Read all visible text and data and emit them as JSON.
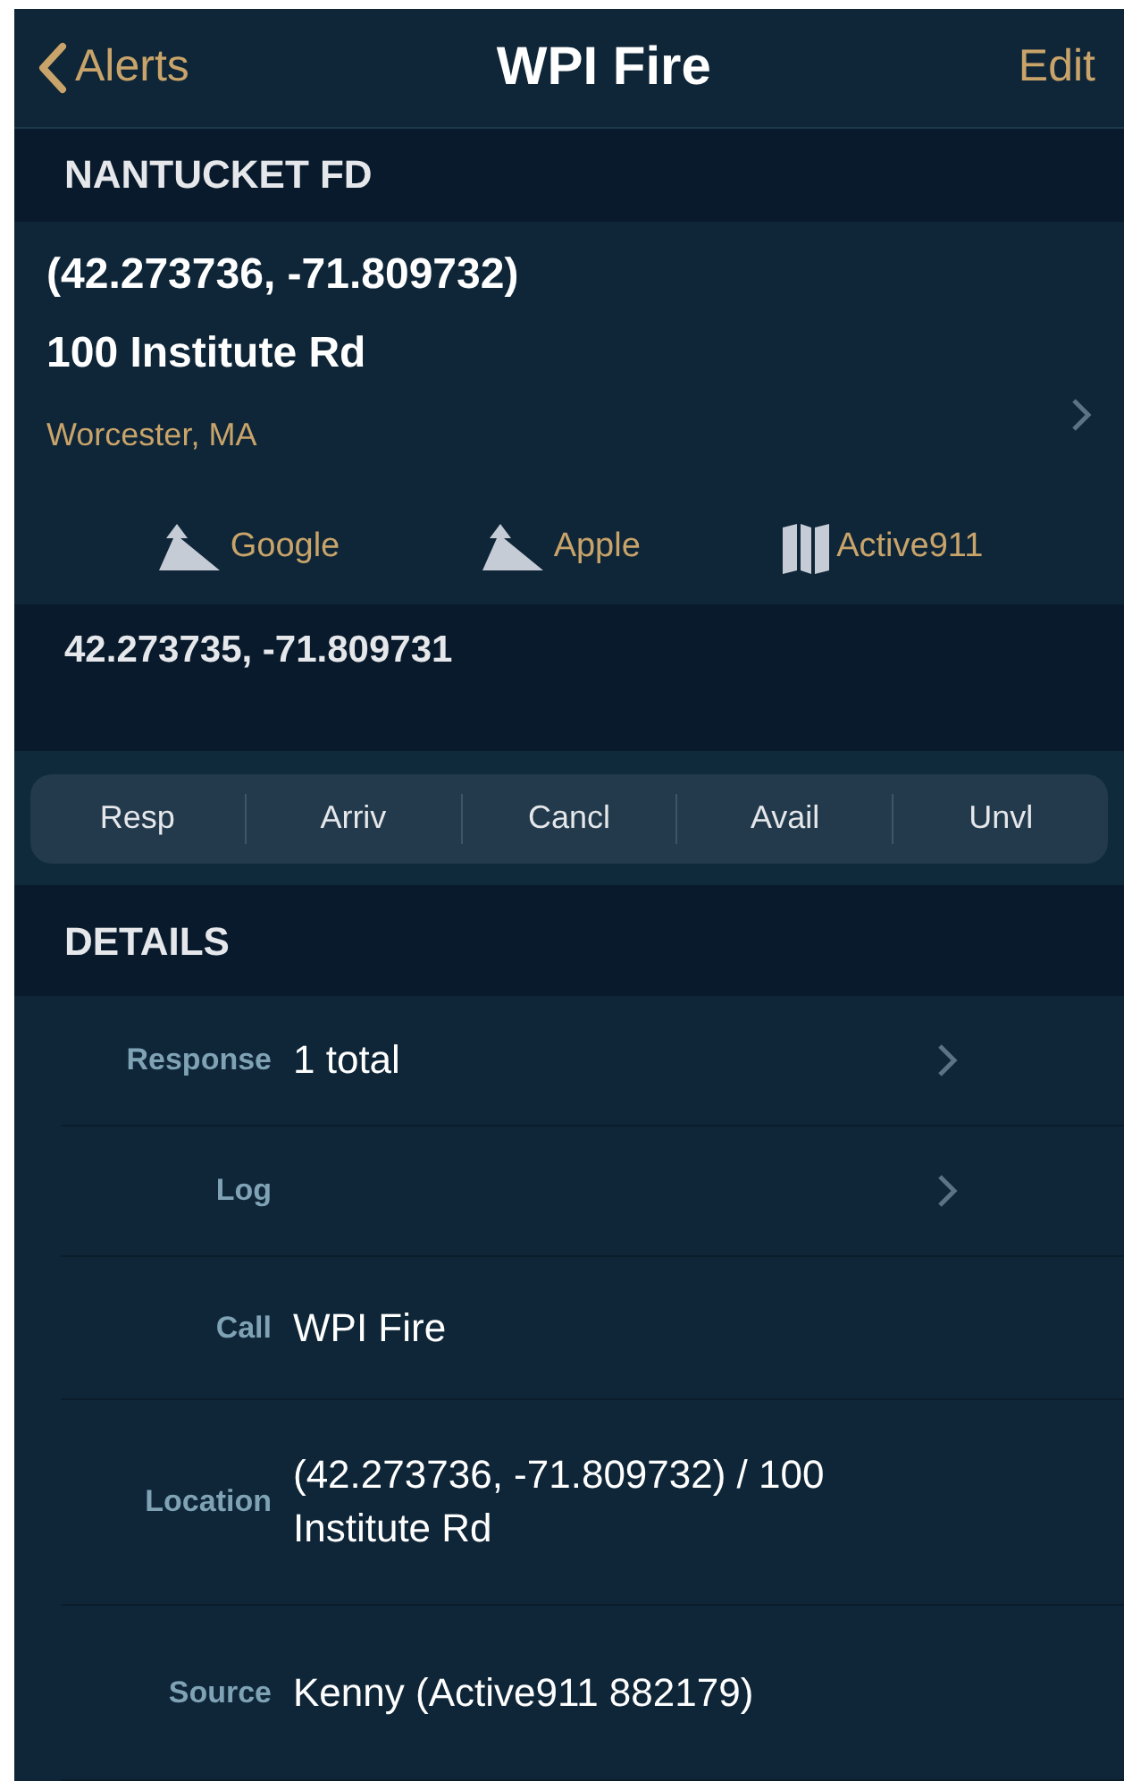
{
  "nav": {
    "back": "Alerts",
    "title": "WPI Fire",
    "action": "Edit"
  },
  "agency": "NANTUCKET FD",
  "address": {
    "coordinates": "(42.273736, -71.809732)",
    "street": "100 Institute Rd",
    "city": "Worcester, MA"
  },
  "map_links": [
    {
      "kind": "directions",
      "label": "Google"
    },
    {
      "kind": "directions",
      "label": "Apple"
    },
    {
      "kind": "map",
      "label": "Active911"
    }
  ],
  "gps": "42.273735, -71.809731",
  "status_buttons": [
    "Resp",
    "Arriv",
    "Cancl",
    "Avail",
    "Unvl"
  ],
  "details": {
    "title": "DETAILS",
    "rows": [
      {
        "label": "Response",
        "value": "1 total",
        "chevron": true
      },
      {
        "label": "Log",
        "chevron": true
      },
      {
        "label": "Call",
        "value": "WPI Fire",
        "chevron": false
      },
      {
        "label": "Location",
        "value": "(42.273736, -71.809732) / 100 Institute Rd",
        "chevron": false
      },
      {
        "label": "Source",
        "value": "Kenny (Active911 882179)",
        "chevron": false
      }
    ]
  }
}
